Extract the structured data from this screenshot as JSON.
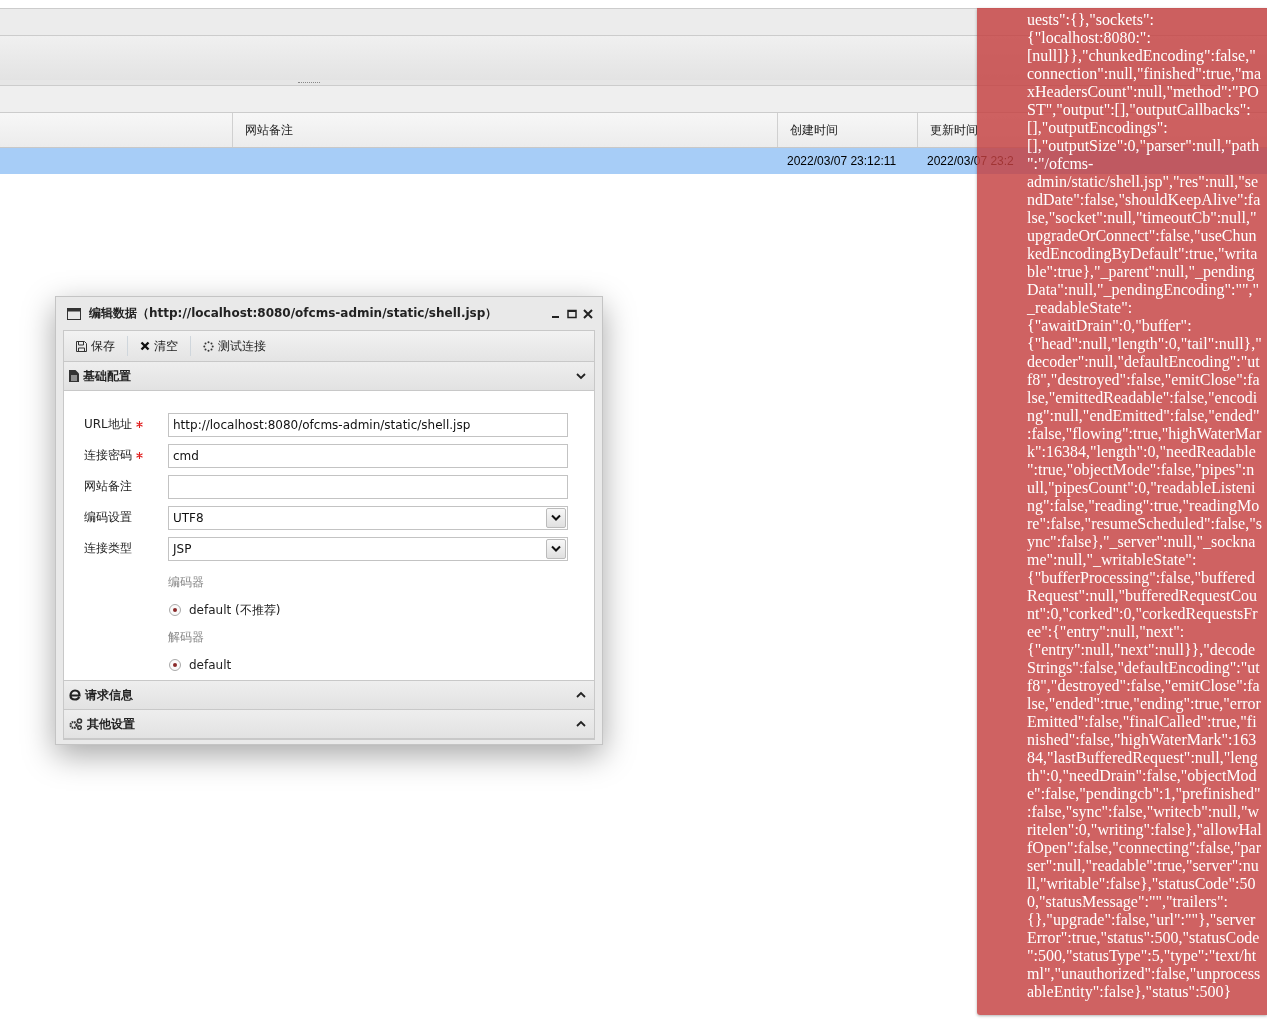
{
  "table": {
    "columns": [
      "网站备注",
      "创建时间",
      "更新时间"
    ],
    "rows": [
      {
        "selected": true,
        "created": "2022/03/07 23:12:11",
        "updated": "2022/03/07 23:2"
      }
    ]
  },
  "dialog": {
    "title": "编辑数据（http://localhost:8080/ofcms-admin/static/shell.jsp）",
    "toolbar": [
      {
        "kind": "save",
        "label": "保存"
      },
      {
        "kind": "clear",
        "label": "清空"
      },
      {
        "kind": "test",
        "label": "测试连接"
      }
    ],
    "sections": [
      {
        "kind": "file",
        "title": "基础配置",
        "expanded": true,
        "fields": [
          {
            "kind": "text",
            "label": "URL地址",
            "required": true,
            "value": "http://localhost:8080/ofcms-admin/static/shell.jsp"
          },
          {
            "kind": "text",
            "label": "连接密码",
            "required": true,
            "value": "cmd"
          },
          {
            "kind": "text",
            "label": "网站备注",
            "required": false
          },
          {
            "kind": "select",
            "label": "编码设置",
            "required": false,
            "value": "UTF8"
          },
          {
            "kind": "select",
            "label": "连接类型",
            "required": false,
            "value": "JSP"
          }
        ],
        "groups": [
          {
            "label": "编码器",
            "options": [
              {
                "label": "default (不推荐)",
                "selected": true
              }
            ]
          },
          {
            "label": "解码器",
            "options": [
              {
                "label": "default",
                "selected": true
              }
            ]
          }
        ]
      },
      {
        "kind": "web",
        "title": "请求信息",
        "expanded": false
      },
      {
        "kind": "gears",
        "title": "其他设置",
        "expanded": false
      }
    ]
  },
  "toast": {
    "lines": [
      "uests\":{},\"sockets\":",
      "{\"localhost:8080:\":",
      "[null]}},\"chunkedEncoding\":false,\"",
      "connection\":null,\"finished\":true,\"ma",
      "xHeadersCount\":null,\"method\":\"PO",
      "ST\",\"output\":[],\"outputCallbacks\":",
      "[],\"outputEncodings\":",
      "[],\"outputSize\":0,\"parser\":null,\"path",
      "\":\"/ofcms-",
      "admin/static/shell.jsp\",\"res\":null,\"se",
      "ndDate\":false,\"shouldKeepAlive\":fa",
      "lse,\"socket\":null,\"timeoutCb\":null,\"",
      "upgradeOrConnect\":false,\"useChun",
      "kedEncodingByDefault\":true,\"writa",
      "ble\":true},\"_parent\":null,\"_pending",
      "Data\":null,\"_pendingEncoding\":\"\",\"",
      "_readableState\":",
      "{\"awaitDrain\":0,\"buffer\":",
      "{\"head\":null,\"length\":0,\"tail\":null},\"",
      "decoder\":null,\"defaultEncoding\":\"ut",
      "f8\",\"destroyed\":false,\"emitClose\":fa",
      "lse,\"emittedReadable\":false,\"encodi",
      "ng\":null,\"endEmitted\":false,\"ended\"",
      ":false,\"flowing\":true,\"highWaterMar",
      "k\":16384,\"length\":0,\"needReadable",
      "\":true,\"objectMode\":false,\"pipes\":n",
      "ull,\"pipesCount\":0,\"readableListeni",
      "ng\":false,\"reading\":true,\"readingMo",
      "re\":false,\"resumeScheduled\":false,\"s",
      "ync\":false},\"_server\":null,\"_sockna",
      "me\":null,\"_writableState\":",
      "{\"bufferProcessing\":false,\"buffered",
      "Request\":null,\"bufferedRequestCou",
      "nt\":0,\"corked\":0,\"corkedRequestsFr",
      "ee\":{\"entry\":null,\"next\":",
      "{\"entry\":null,\"next\":null}},\"decode",
      "Strings\":false,\"defaultEncoding\":\"ut",
      "f8\",\"destroyed\":false,\"emitClose\":fa",
      "lse,\"ended\":true,\"ending\":true,\"error",
      "Emitted\":false,\"finalCalled\":true,\"fi",
      "nished\":false,\"highWaterMark\":163",
      "84,\"lastBufferedRequest\":null,\"leng",
      "th\":0,\"needDrain\":false,\"objectMod",
      "e\":false,\"pendingcb\":1,\"prefinished\"",
      ":false,\"sync\":false,\"writecb\":null,\"w",
      "ritelen\":0,\"writing\":false},\"allowHal",
      "fOpen\":false,\"connecting\":false,\"par",
      "ser\":null,\"readable\":true,\"server\":nu",
      "ll,\"writable\":false},\"statusCode\":50",
      "0,\"statusMessage\":\"\",\"trailers\":",
      "{},\"upgrade\":false,\"url\":\"\"},\"server",
      "Error\":true,\"status\":500,\"statusCode",
      "\":500,\"statusType\":5,\"type\":\"text/ht",
      "ml\",\"unauthorized\":false,\"unprocess",
      "ableEntity\":false},\"status\":500}"
    ]
  }
}
